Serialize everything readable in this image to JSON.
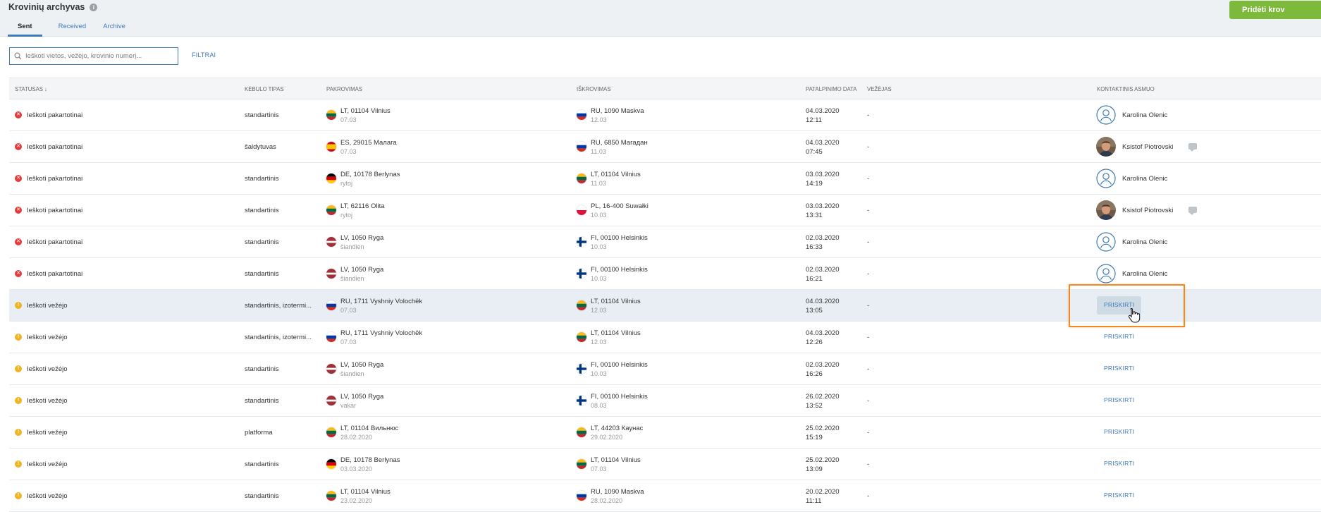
{
  "header": {
    "title": "Krovinių archyvas",
    "add_button": "Pridėti krov"
  },
  "tabs": [
    {
      "label": "Sent",
      "active": true
    },
    {
      "label": "Received",
      "active": false
    },
    {
      "label": "Archive",
      "active": false
    }
  ],
  "search": {
    "placeholder": "Ieškoti vietos, vežėjo, krovinio numerį...",
    "value": ""
  },
  "filters_label": "FILTRAI",
  "columns": {
    "status": "STATUSAS ↓",
    "body_type": "KĖBULO TIPAS",
    "loading": "PAKROVIMAS",
    "unloading": "IŠKROVIMAS",
    "posted": "PATALPINIMO DATA",
    "carrier": "VEŽĖJAS",
    "contact": "KONTAKTINIS ASMUO"
  },
  "rows": [
    {
      "status_type": "err",
      "status": "Ieškoti pakartotinai",
      "body": "standartinis",
      "load_flag": "LT",
      "load_place": "LT, 01104 Vilnius",
      "load_date": "07.03",
      "unload_flag": "RU",
      "unload_place": "RU, 1090 Maskva",
      "unload_date": "12.03",
      "posted_date": "04.03.2020",
      "posted_time": "12:11",
      "carrier": "-",
      "contact": "Karolina Olenic",
      "avatar": "placeholder",
      "chat": false,
      "assign": ""
    },
    {
      "status_type": "err",
      "status": "Ieškoti pakartotinai",
      "body": "šaldytuvas",
      "load_flag": "ES",
      "load_place": "ES, 29015 Малага",
      "load_date": "07.03",
      "unload_flag": "RU",
      "unload_place": "RU, 6850 Магадан",
      "unload_date": "11.03",
      "posted_date": "04.03.2020",
      "posted_time": "07:45",
      "carrier": "-",
      "contact": "Ksistof Piotrovski",
      "avatar": "photo",
      "chat": true,
      "assign": ""
    },
    {
      "status_type": "err",
      "status": "Ieškoti pakartotinai",
      "body": "standartinis",
      "load_flag": "DE",
      "load_place": "DE, 10178 Berlynas",
      "load_date": "rytoj",
      "unload_flag": "LT",
      "unload_place": "LT, 01104 Vilnius",
      "unload_date": "11.03",
      "posted_date": "03.03.2020",
      "posted_time": "14:19",
      "carrier": "-",
      "contact": "Karolina Olenic",
      "avatar": "placeholder",
      "chat": false,
      "assign": ""
    },
    {
      "status_type": "err",
      "status": "Ieškoti pakartotinai",
      "body": "standartinis",
      "load_flag": "LT",
      "load_place": "LT, 62116 Olita",
      "load_date": "rytoj",
      "unload_flag": "PL",
      "unload_place": "PL, 16-400 Suwałki",
      "unload_date": "10.03",
      "posted_date": "03.03.2020",
      "posted_time": "13:31",
      "carrier": "-",
      "contact": "Ksistof Piotrovski",
      "avatar": "photo",
      "chat": true,
      "assign": ""
    },
    {
      "status_type": "err",
      "status": "Ieškoti pakartotinai",
      "body": "standartinis",
      "load_flag": "LV",
      "load_place": "LV, 1050 Ryga",
      "load_date": "šiandien",
      "unload_flag": "FI",
      "unload_place": "FI, 00100 Helsinkis",
      "unload_date": "10.03",
      "posted_date": "02.03.2020",
      "posted_time": "16:33",
      "carrier": "-",
      "contact": "Karolina Olenic",
      "avatar": "placeholder",
      "chat": false,
      "assign": ""
    },
    {
      "status_type": "err",
      "status": "Ieškoti pakartotinai",
      "body": "standartinis",
      "load_flag": "LV",
      "load_place": "LV, 1050 Ryga",
      "load_date": "šiandien",
      "unload_flag": "FI",
      "unload_place": "FI, 00100 Helsinkis",
      "unload_date": "10.03",
      "posted_date": "02.03.2020",
      "posted_time": "16:21",
      "carrier": "-",
      "contact": "Karolina Olenic",
      "avatar": "placeholder",
      "chat": false,
      "assign": ""
    },
    {
      "status_type": "warn",
      "status": "Ieškoti vežėjo",
      "body": "standartinis, izotermi...",
      "load_flag": "RU",
      "load_place": "RU, 1711 Vyshniy Volochëk",
      "load_date": "07.03",
      "unload_flag": "LT",
      "unload_place": "LT, 01104 Vilnius",
      "unload_date": "12.03",
      "posted_date": "04.03.2020",
      "posted_time": "13:05",
      "carrier": "-",
      "contact": "",
      "avatar": "",
      "chat": false,
      "assign": "PRISKIRTI",
      "highlight": true
    },
    {
      "status_type": "warn",
      "status": "Ieškoti vežėjo",
      "body": "standartinis, izotermi...",
      "load_flag": "RU",
      "load_place": "RU, 1711 Vyshniy Volochëk",
      "load_date": "07.03",
      "unload_flag": "LT",
      "unload_place": "LT, 01104 Vilnius",
      "unload_date": "12.03",
      "posted_date": "04.03.2020",
      "posted_time": "12:26",
      "carrier": "-",
      "contact": "",
      "avatar": "",
      "chat": false,
      "assign": "PRISKIRTI"
    },
    {
      "status_type": "warn",
      "status": "Ieškoti vežėjo",
      "body": "standartinis",
      "load_flag": "LV",
      "load_place": "LV, 1050 Ryga",
      "load_date": "šiandien",
      "unload_flag": "FI",
      "unload_place": "FI, 00100 Helsinkis",
      "unload_date": "10.03",
      "posted_date": "02.03.2020",
      "posted_time": "16:26",
      "carrier": "-",
      "contact": "",
      "avatar": "",
      "chat": false,
      "assign": "PRISKIRTI"
    },
    {
      "status_type": "warn",
      "status": "Ieškoti vežėjo",
      "body": "standartinis",
      "load_flag": "LV",
      "load_place": "LV, 1050 Ryga",
      "load_date": "vakar",
      "unload_flag": "FI",
      "unload_place": "FI, 00100 Helsinkis",
      "unload_date": "08.03",
      "posted_date": "26.02.2020",
      "posted_time": "13:52",
      "carrier": "-",
      "contact": "",
      "avatar": "",
      "chat": false,
      "assign": "PRISKIRTI"
    },
    {
      "status_type": "warn",
      "status": "Ieškoti vežėjo",
      "body": "platforma",
      "load_flag": "LT",
      "load_place": "LT, 01104 Вильнюс",
      "load_date": "28.02.2020",
      "unload_flag": "LT",
      "unload_place": "LT, 44203 Каунас",
      "unload_date": "29.02.2020",
      "posted_date": "25.02.2020",
      "posted_time": "15:19",
      "carrier": "-",
      "contact": "",
      "avatar": "",
      "chat": false,
      "assign": "PRISKIRTI"
    },
    {
      "status_type": "warn",
      "status": "Ieškoti vežėjo",
      "body": "standartinis",
      "load_flag": "DE",
      "load_place": "DE, 10178 Berlynas",
      "load_date": "03.03.2020",
      "unload_flag": "LT",
      "unload_place": "LT, 01104 Vilnius",
      "unload_date": "07.03",
      "posted_date": "25.02.2020",
      "posted_time": "13:09",
      "carrier": "-",
      "contact": "",
      "avatar": "",
      "chat": false,
      "assign": "PRISKIRTI"
    },
    {
      "status_type": "warn",
      "status": "Ieškoti vežėjo",
      "body": "standartinis",
      "load_flag": "LT",
      "load_place": "LT, 01104 Vilnius",
      "load_date": "23.02.2020",
      "unload_flag": "RU",
      "unload_place": "RU, 1090 Maskva",
      "unload_date": "28.02.2020",
      "posted_date": "20.02.2020",
      "posted_time": "11:11",
      "carrier": "-",
      "contact": "",
      "avatar": "",
      "chat": false,
      "assign": "PRISKIRTI"
    }
  ],
  "colors": {
    "accent": "#3d7ab8",
    "add_button": "#7dba3c",
    "error": "#e23c3c",
    "warning": "#f2b321",
    "highlight_box": "#f08a24"
  },
  "icons": {
    "search": "search-icon",
    "info": "info-icon",
    "error": "error-status-icon",
    "warning": "warning-status-icon",
    "chat": "chat-icon",
    "avatar": "user-avatar-icon"
  }
}
